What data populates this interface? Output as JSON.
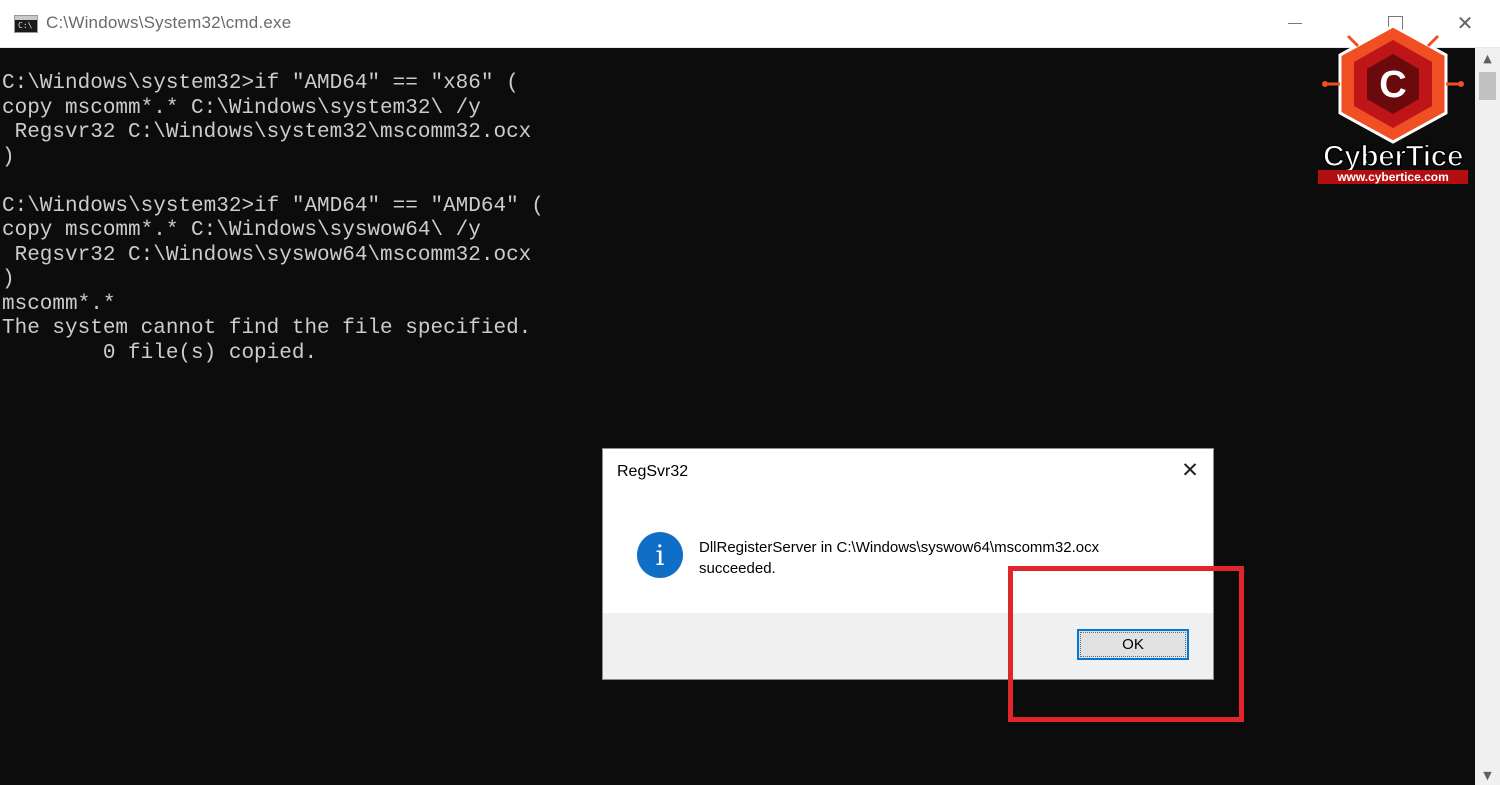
{
  "window": {
    "title": "C:\\Windows\\System32\\cmd.exe",
    "icon": "cmd-icon",
    "icon_glyph": "C:\\",
    "minimize_glyph": "",
    "maximize_glyph": "",
    "close_glyph": "✕"
  },
  "console": {
    "text": "C:\\Windows\\system32>if \"AMD64\" == \"x86\" (\ncopy mscomm*.* C:\\Windows\\system32\\ /y\n Regsvr32 C:\\Windows\\system32\\mscomm32.ocx\n)\n\nC:\\Windows\\system32>if \"AMD64\" == \"AMD64\" (\ncopy mscomm*.* C:\\Windows\\syswow64\\ /y\n Regsvr32 C:\\Windows\\syswow64\\mscomm32.ocx\n)\nmscomm*.*\nThe system cannot find the file specified.\n        0 file(s) copied."
  },
  "scrollbar": {
    "up_glyph": "▲",
    "down_glyph": "▼"
  },
  "logo": {
    "letter": "C",
    "name": "CyberTice",
    "url": "www.cybertice.com",
    "colors": {
      "orange": "#f04e23",
      "red": "#c01518",
      "dark": "#6b0a0c"
    }
  },
  "dialog": {
    "title": "RegSvr32",
    "close_glyph": "✕",
    "icon": "info-icon",
    "icon_glyph": "i",
    "message_line1": "DllRegisterServer in C:\\Windows\\syswow64\\mscomm32.ocx",
    "message_line2": "succeeded.",
    "ok_label": "OK",
    "accent": "#0078d7"
  },
  "annotation": {
    "highlight_color": "#e0262c"
  }
}
